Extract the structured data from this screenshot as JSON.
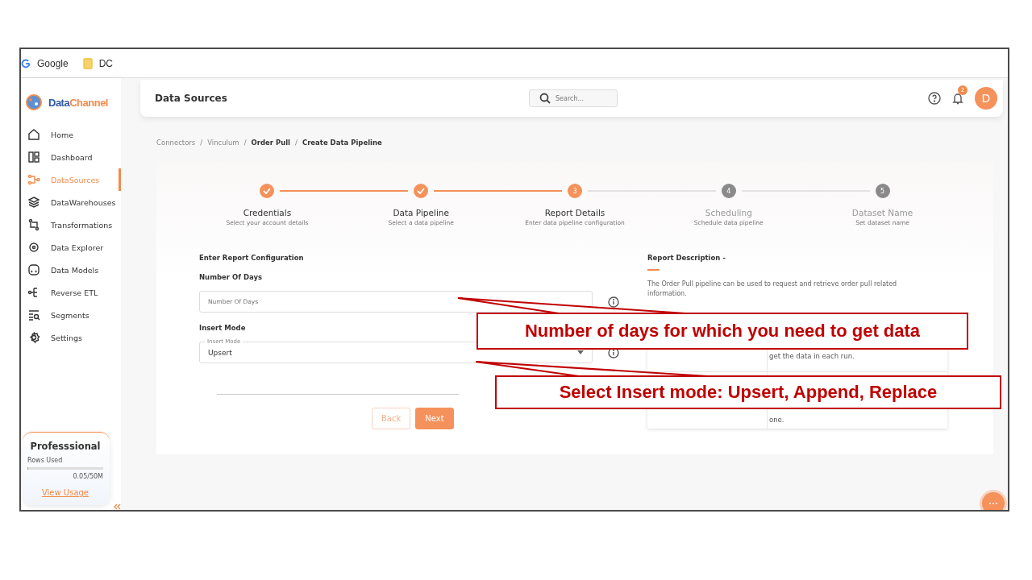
{
  "browser_bar": {
    "bookmarks": [
      {
        "label": "Google",
        "kind": "google"
      },
      {
        "label": "DC",
        "kind": "folder"
      }
    ]
  },
  "sidebar": {
    "logo": {
      "part_1": "Data",
      "part_2": "Channel"
    },
    "items": [
      {
        "label": "Home",
        "selected": false
      },
      {
        "label": "Dashboard",
        "selected": false
      },
      {
        "label": "DataSources",
        "selected": true
      },
      {
        "label": "DataWarehouses",
        "selected": false
      },
      {
        "label": "Transformations",
        "selected": false
      },
      {
        "label": "Data Explorer",
        "selected": false
      },
      {
        "label": "Data Models",
        "selected": false
      },
      {
        "label": "Reverse ETL",
        "selected": false
      },
      {
        "label": "Segments",
        "selected": false
      },
      {
        "label": "Settings",
        "selected": false
      }
    ],
    "plan": {
      "title": "Professsional",
      "rows_label": "Rows Used",
      "level": 0.001,
      "usage": "0.05/50M",
      "link": "View Usage"
    }
  },
  "header": {
    "title": "Data Sources",
    "search": {
      "placeholder": "Search..."
    },
    "notifications": "2",
    "avatar": "D"
  },
  "breadcrumb": [
    {
      "label": "Connectors",
      "current": false
    },
    {
      "separator": "/",
      "label": "Vinculum",
      "current": false
    },
    {
      "separator": "/",
      "label": "Order Pull",
      "current": true
    },
    {
      "separator": "/",
      "label": "Create Data Pipeline",
      "current": true
    }
  ],
  "stepper": [
    {
      "title": "Credentials",
      "subtitle": "Select your account details",
      "completed": true,
      "active": false
    },
    {
      "title": "Data Pipeline",
      "subtitle": "Select a data pipeline",
      "completed": true,
      "active": false
    },
    {
      "number": "3",
      "title": "Report Details",
      "subtitle": "Enter data pipeline configuration",
      "completed": false,
      "active": true
    },
    {
      "number": "4",
      "title": "Scheduling",
      "subtitle": "Schedule data pipeline",
      "completed": false,
      "active": false
    },
    {
      "number": "5",
      "title": "Dataset Name",
      "subtitle": "Set dataset name",
      "completed": false,
      "active": false
    }
  ],
  "form": {
    "heading": "Enter Report Configuration",
    "fields": [
      {
        "label": "Number Of Days",
        "kind": "text",
        "placeholder": "Number Of Days"
      },
      {
        "label": "Insert Mode",
        "kind": "select",
        "floating_label": "Insert Mode",
        "value": "Upsert"
      }
    ],
    "buttons": [
      {
        "label": "Back",
        "kind": "secondary"
      },
      {
        "label": "Next",
        "kind": "primary"
      }
    ]
  },
  "description": {
    "title": "Report Description -",
    "text": "The Order Pull pipeline can be used to request and retrieve order pull related information.",
    "table": {
      "rows": [
        {
          "column_2": "get the data in each run."
        },
        {
          "column_2": "one."
        }
      ]
    }
  },
  "callouts": [
    {
      "text": "Number of days for which you need to get data"
    },
    {
      "text": "Select Insert mode: Upsert, Append, Replace"
    }
  ]
}
